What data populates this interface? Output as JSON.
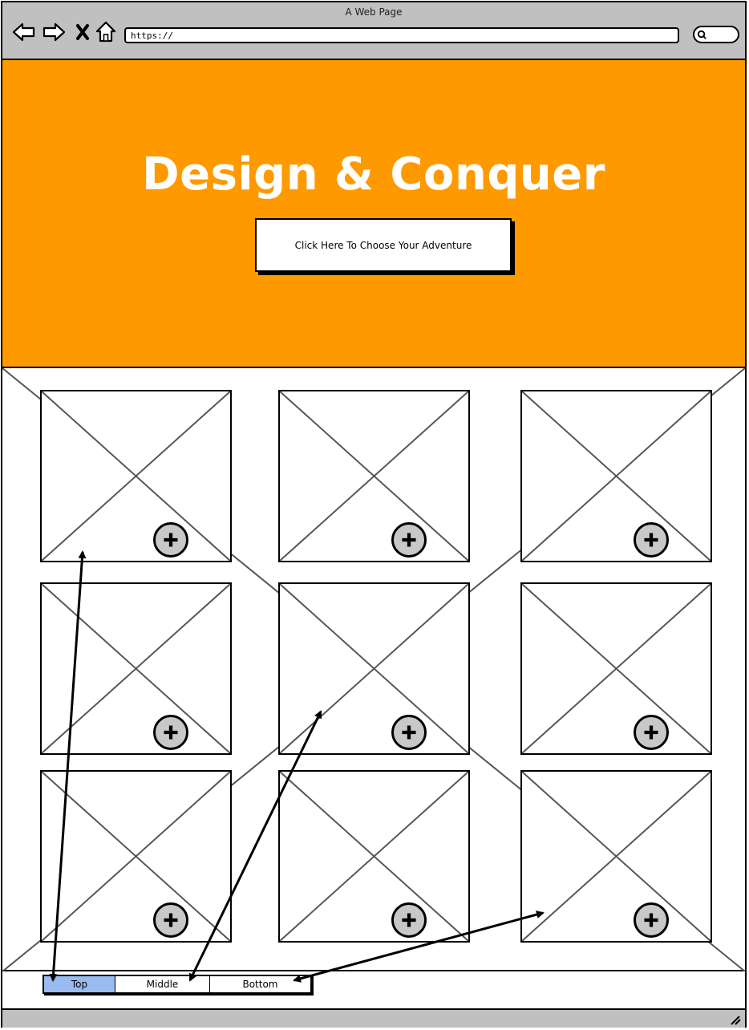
{
  "window": {
    "title": "A Web Page"
  },
  "browser": {
    "url": "https://",
    "icons": [
      "back-icon",
      "forward-icon",
      "close-icon",
      "home-icon",
      "search-icon"
    ]
  },
  "hero": {
    "title": "Design & Conquer",
    "button_label": "Click Here To Choose Your Adventure",
    "background_color": "#ff9900"
  },
  "gallery": {
    "rows": 3,
    "columns": 3,
    "tile_icon": "image-placeholder-icon",
    "action_icon": "plus-icon"
  },
  "tabs": {
    "items": [
      {
        "label": "Top",
        "active": true
      },
      {
        "label": "Middle",
        "active": false
      },
      {
        "label": "Bottom",
        "active": false
      }
    ],
    "active_color": "#99bbf0"
  }
}
